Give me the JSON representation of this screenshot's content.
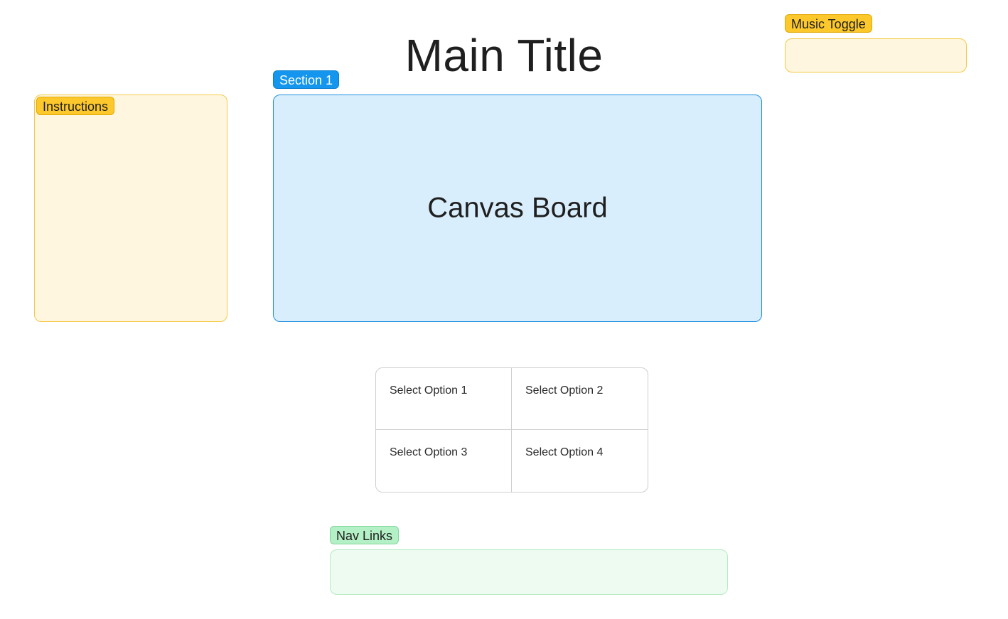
{
  "header": {
    "title": "Main Title"
  },
  "music_toggle": {
    "label": "Music Toggle"
  },
  "instructions": {
    "label": "Instructions"
  },
  "section": {
    "label": "Section 1",
    "canvas_label": "Canvas Board"
  },
  "options": [
    "Select Option 1",
    "Select Option 2",
    "Select Option 3",
    "Select Option 4"
  ],
  "nav": {
    "label": "Nav Links"
  },
  "colors": {
    "yellow_tag": "#fcc82b",
    "yellow_panel": "#fff6e0",
    "blue_tag": "#1496ee",
    "blue_panel": "#d9eefc",
    "green_tag": "#b4f0c6",
    "green_panel": "#eefbf1"
  }
}
